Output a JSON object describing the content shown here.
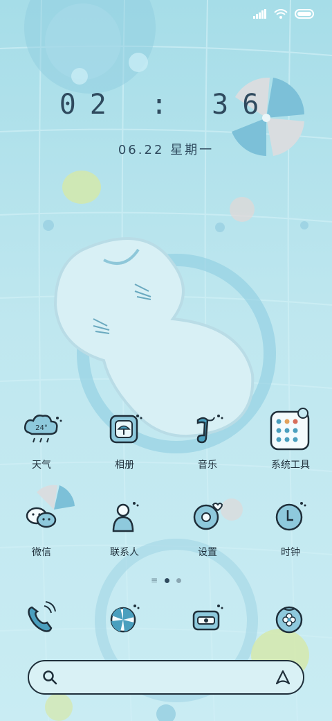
{
  "status_bar": {
    "icons": [
      "signal-icon",
      "wifi-icon",
      "battery-icon"
    ]
  },
  "lockscreen": {
    "time": "02 : 36",
    "date": "06.22 星期一"
  },
  "weather": {
    "temperature": "24°"
  },
  "apps_row1": [
    {
      "label": "天气",
      "icon": "weather-cloud-icon"
    },
    {
      "label": "相册",
      "icon": "album-photo-icon"
    },
    {
      "label": "音乐",
      "icon": "music-note-icon"
    },
    {
      "label": "系统工具",
      "icon": "system-tools-folder-icon"
    }
  ],
  "apps_row2": [
    {
      "label": "微信",
      "icon": "wechat-chat-icon"
    },
    {
      "label": "联系人",
      "icon": "contacts-person-icon"
    },
    {
      "label": "设置",
      "icon": "settings-donut-icon"
    },
    {
      "label": "时钟",
      "icon": "clock-icon"
    }
  ],
  "dock": [
    {
      "icon": "phone-icon"
    },
    {
      "icon": "browser-candy-icon"
    },
    {
      "icon": "messages-camera-icon"
    },
    {
      "icon": "app-store-flower-icon"
    }
  ],
  "page_indicator": {
    "pages": 3,
    "current_page": 2
  },
  "colors": {
    "outline": "#1f2f3a",
    "accent": "#4a9fbe",
    "fill": "#c6eaf3"
  }
}
